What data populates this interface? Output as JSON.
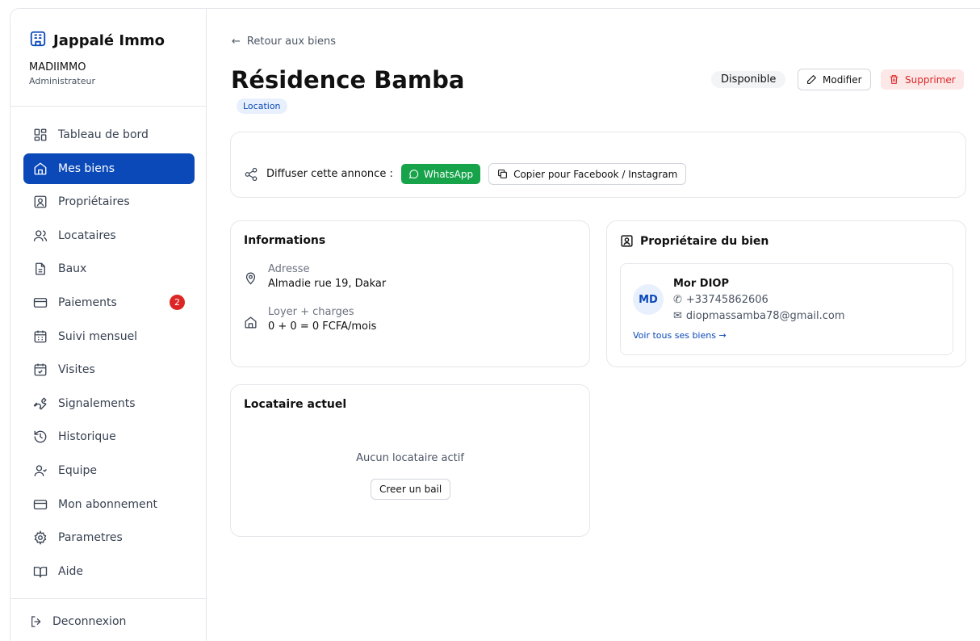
{
  "brand": {
    "name": "Jappalé Immo"
  },
  "account": {
    "org": "MADIIMMO",
    "role": "Administrateur"
  },
  "nav": {
    "items": [
      {
        "label": "Tableau de bord"
      },
      {
        "label": "Mes biens"
      },
      {
        "label": "Propriétaires"
      },
      {
        "label": "Locataires"
      },
      {
        "label": "Baux"
      },
      {
        "label": "Paiements",
        "badge": "2"
      },
      {
        "label": "Suivi mensuel"
      },
      {
        "label": "Visites"
      },
      {
        "label": "Signalements"
      },
      {
        "label": "Historique"
      },
      {
        "label": "Equipe"
      },
      {
        "label": "Mon abonnement"
      },
      {
        "label": "Parametres"
      },
      {
        "label": "Aide"
      }
    ],
    "logout": "Deconnexion"
  },
  "page": {
    "back": "Retour aux biens",
    "title": "Résidence Bamba",
    "tag": "Location",
    "status": "Disponible",
    "edit": "Modifier",
    "delete": "Supprimer"
  },
  "share": {
    "label": "Diffuser cette annonce :",
    "whatsapp": "WhatsApp",
    "copy": "Copier pour Facebook / Instagram"
  },
  "info": {
    "title": "Informations",
    "address_label": "Adresse",
    "address_value": "Almadie rue 19, Dakar",
    "rent_label": "Loyer + charges",
    "rent_value": "0 + 0 = 0 FCFA/mois"
  },
  "owner": {
    "title": "Propriétaire du bien",
    "initials": "MD",
    "name": "Mor DIOP",
    "phone": "+33745862606",
    "email": "diopmassamba78@gmail.com",
    "link": "Voir tous ses biens →"
  },
  "tenant": {
    "title": "Locataire actuel",
    "empty": "Aucun locataire actif",
    "button": "Creer un bail"
  },
  "colors": {
    "primary": "#0b49b8",
    "whatsapp": "#16a34a",
    "danger": "#dc2626"
  }
}
